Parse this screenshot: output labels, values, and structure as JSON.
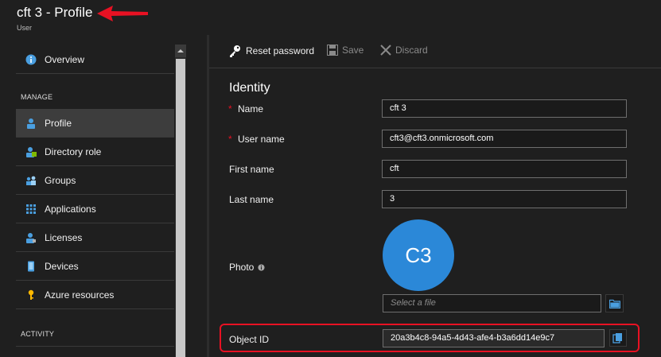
{
  "header": {
    "title": "cft 3 - Profile",
    "subtitle": "User"
  },
  "sidebar": {
    "overview": "Overview",
    "manage_label": "MANAGE",
    "items": [
      {
        "label": "Profile",
        "icon": "user-icon"
      },
      {
        "label": "Directory role",
        "icon": "directory-role-icon"
      },
      {
        "label": "Groups",
        "icon": "groups-icon"
      },
      {
        "label": "Applications",
        "icon": "applications-grid-icon"
      },
      {
        "label": "Licenses",
        "icon": "license-icon"
      },
      {
        "label": "Devices",
        "icon": "device-icon"
      },
      {
        "label": "Azure resources",
        "icon": "key-icon"
      }
    ],
    "activity_label": "ACTIVITY"
  },
  "toolbar": {
    "reset_password": "Reset password",
    "save": "Save",
    "discard": "Discard"
  },
  "identity": {
    "title": "Identity",
    "required_mark": "*",
    "name_label": "Name",
    "name_value": "cft 3",
    "username_label": "User name",
    "username_value": "cft3@cft3.onmicrosoft.com",
    "firstname_label": "First name",
    "firstname_value": "cft",
    "lastname_label": "Last name",
    "lastname_value": "3",
    "photo_label": "Photo",
    "avatar_initials": "C3",
    "file_placeholder": "Select a file",
    "objectid_label": "Object ID",
    "objectid_value": "20a3b4c8-94a5-4d43-afe4-b3a6dd14e9c7"
  },
  "colors": {
    "background": "#1f1f1f",
    "accent": "#2b88d8",
    "highlight": "#e81123",
    "active_nav": "#3d3d3d"
  }
}
